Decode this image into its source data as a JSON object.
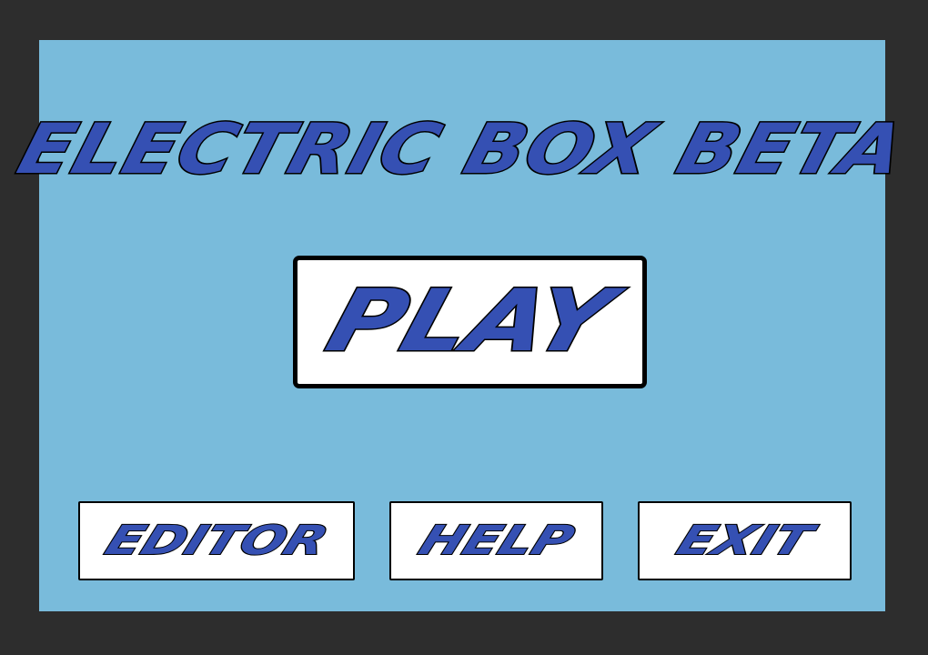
{
  "game": {
    "title": "ELECTRIC BOX BETA"
  },
  "menu": {
    "play_label": "PLAY",
    "editor_label": "EDITOR",
    "help_label": "HELP",
    "exit_label": "EXIT"
  },
  "colors": {
    "frame": "#2d2d2d",
    "background": "#79bbdb",
    "text_fill": "#3550b3",
    "text_outline": "#000000",
    "button_fill": "#ffffff"
  }
}
